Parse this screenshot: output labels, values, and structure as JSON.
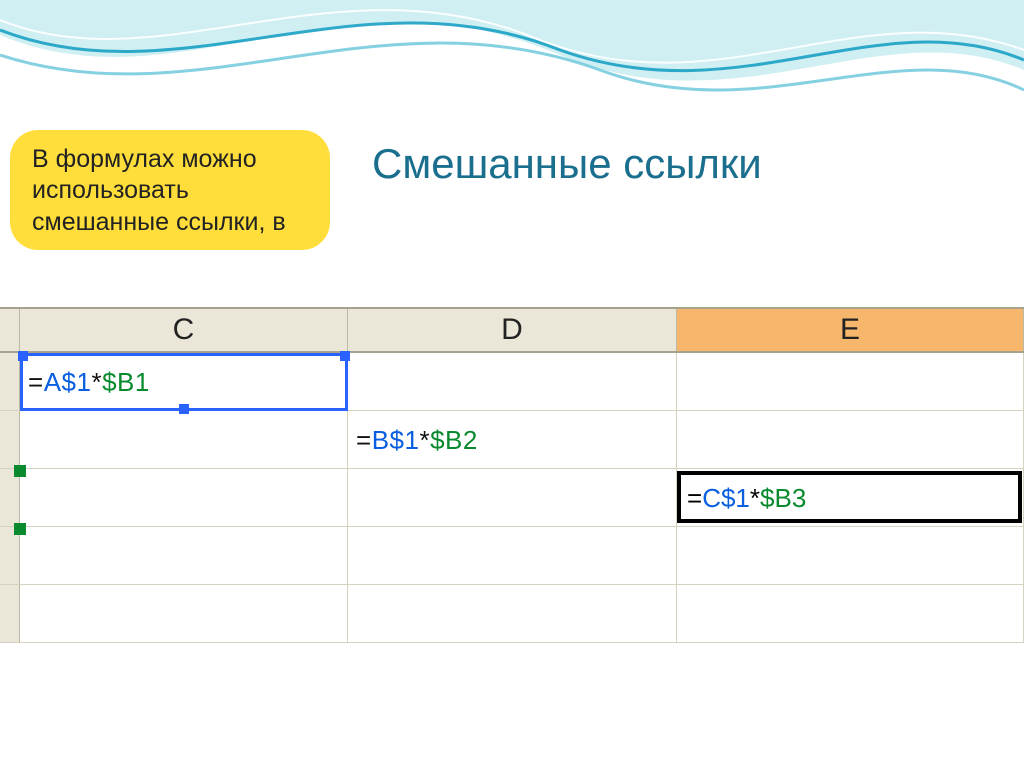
{
  "title": "Смешанные ссылки",
  "callout": "   В формулах можно использовать смешанные ссылки, в",
  "columns": {
    "c": "C",
    "d": "D",
    "e": "E"
  },
  "formulas": {
    "c1": {
      "eq": "=",
      "ref1": "A$1",
      "star": "*",
      "ref2": "$B1"
    },
    "d2": {
      "eq": "=",
      "ref1": "B$1",
      "star": "*",
      "ref2": "$B2"
    },
    "e3": {
      "eq": "=",
      "ref1": "C$1",
      "star": "*",
      "ref2": "$B3"
    }
  }
}
